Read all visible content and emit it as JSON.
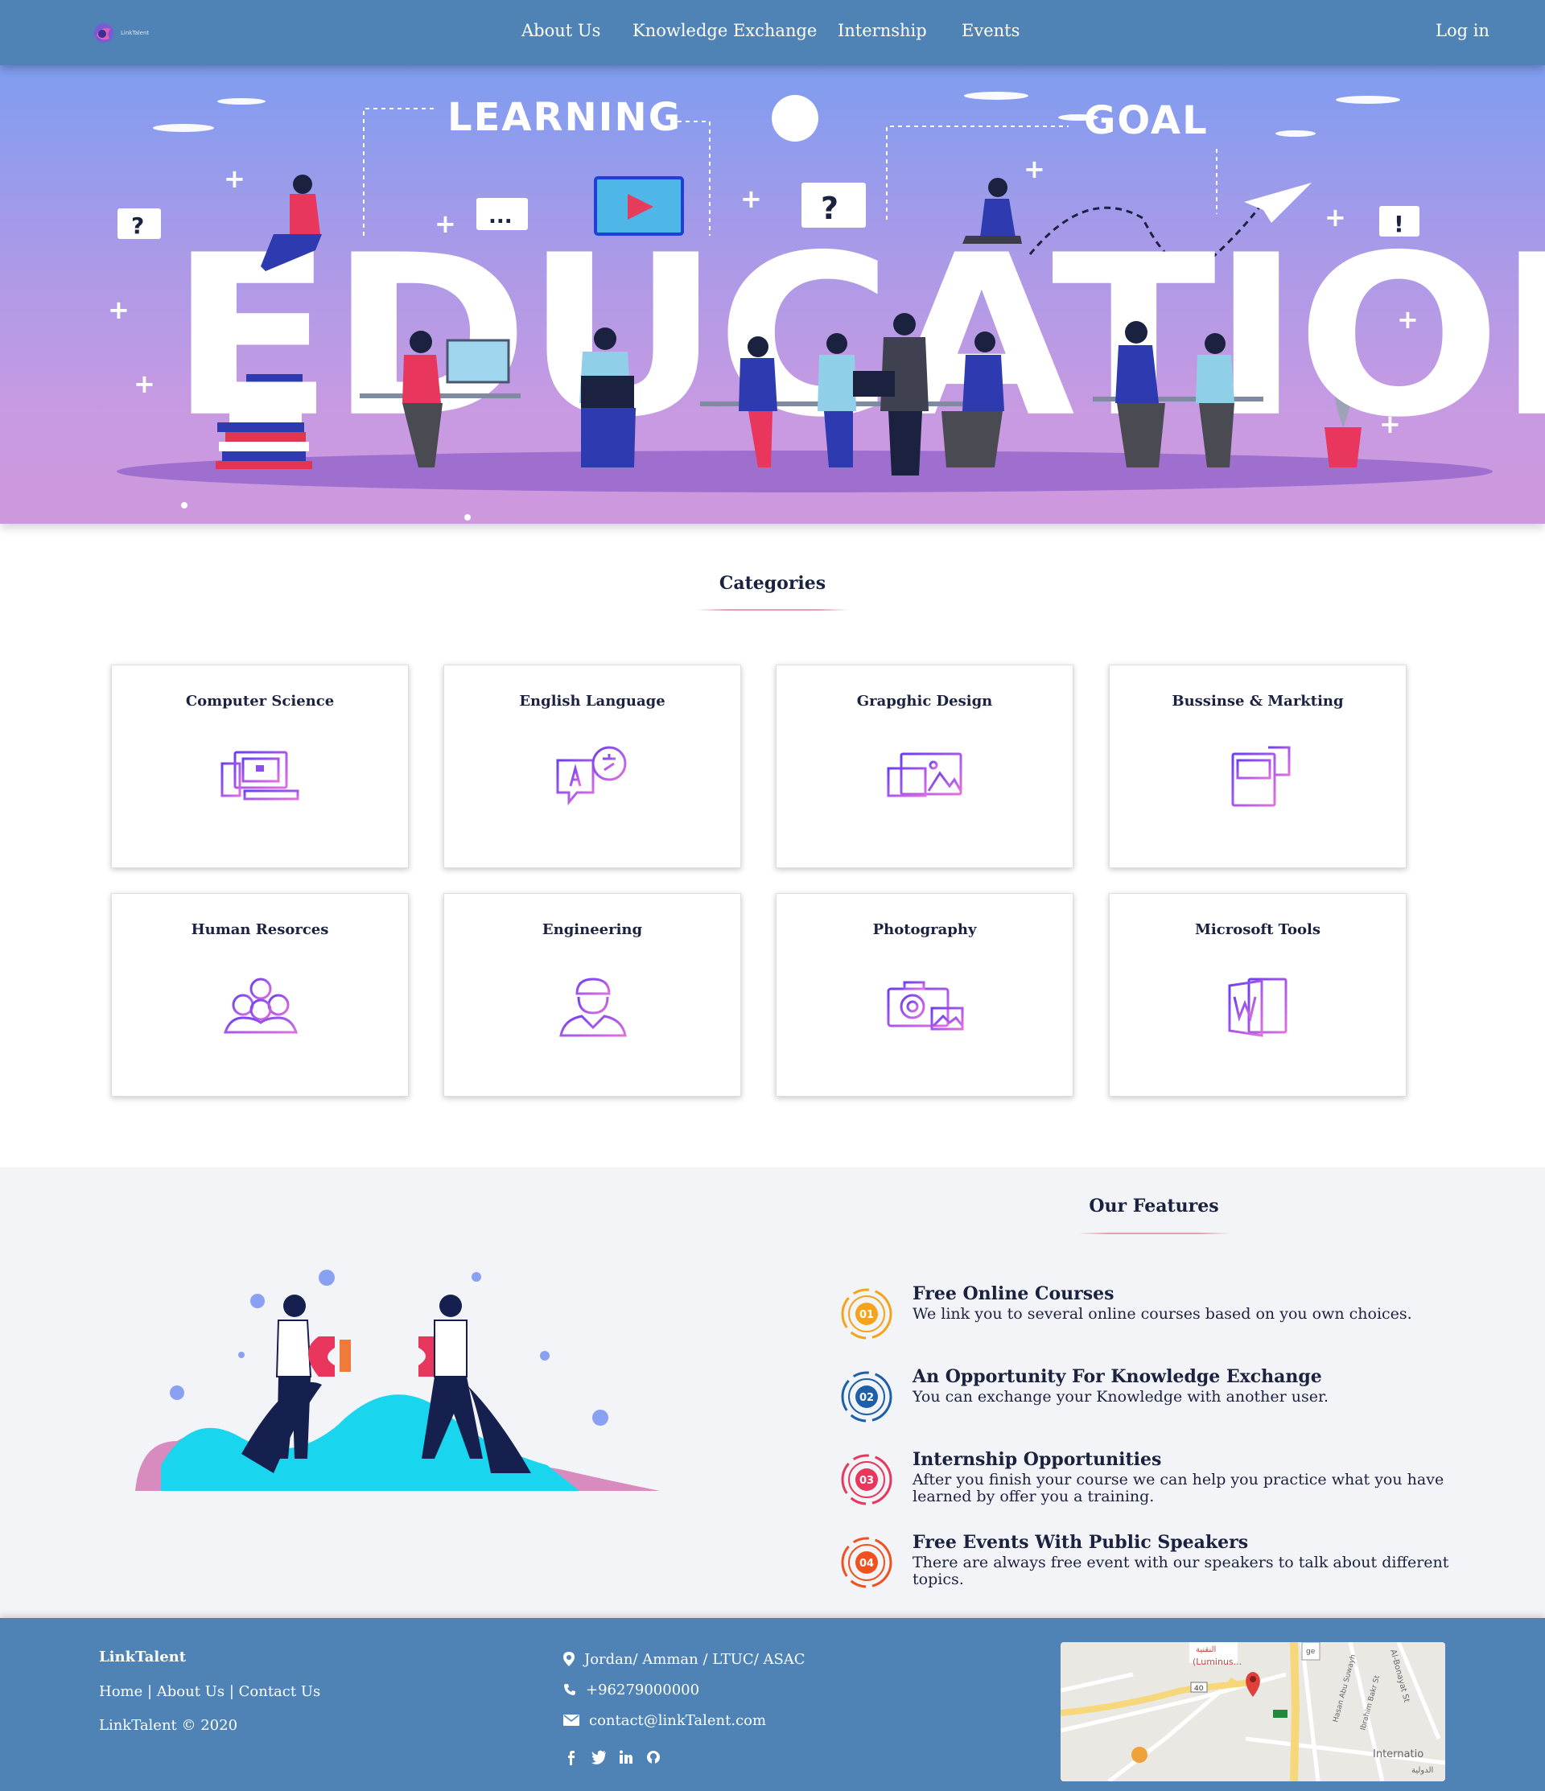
{
  "navbar": {
    "logo_text": "LinkTalent",
    "links": [
      "About Us",
      "Knowledge Exchange",
      "Internship",
      "Events"
    ],
    "login": "Log in"
  },
  "hero": {
    "word_learning": "LEARNING",
    "word_goal": "GOAL",
    "word_education": "EDUCATION",
    "bubble_question": "?",
    "bubble_dots": "...",
    "bubble_exclaim": "!"
  },
  "categories": {
    "title": "Categories",
    "items": [
      {
        "label": "Computer Science",
        "icon": "computer-icon"
      },
      {
        "label": "English Language",
        "icon": "language-icon"
      },
      {
        "label": "Grapghic Design",
        "icon": "graphic-design-icon"
      },
      {
        "label": "Bussinse & Markting",
        "icon": "business-document-icon"
      },
      {
        "label": "Human Resorces",
        "icon": "people-group-icon"
      },
      {
        "label": "Engineering",
        "icon": "engineer-icon"
      },
      {
        "label": "Photography",
        "icon": "camera-icon"
      },
      {
        "label": "Microsoft Tools",
        "icon": "word-document-icon"
      }
    ]
  },
  "features": {
    "title": "Our Features",
    "items": [
      {
        "num": "01",
        "title": "Free Online Courses",
        "text": "We link you to several online courses based on you own choices.",
        "color": "#f5a31a"
      },
      {
        "num": "02",
        "title": "An Opportunity For Knowledge Exchange",
        "text": "You can exchange your Knowledge with another user.",
        "color": "#1d5fa8"
      },
      {
        "num": "03",
        "title": "Internship Opportunities",
        "text": "After you finish your course we can help you practice what you have learned by offer you a training.",
        "color": "#e8365c"
      },
      {
        "num": "04",
        "title": "Free Events With Public Speakers",
        "text": "There are always free event with our speakers to talk about different topics.",
        "color": "#f0521f"
      }
    ]
  },
  "footer": {
    "brand": "LinkTalent",
    "links": [
      "Home",
      "About Us",
      "Contact Us"
    ],
    "separator": " | ",
    "copyright": "LinkTalent © 2020",
    "address": "Jordan/ Amman / LTUC/ ASAC",
    "phone": "+96279000000",
    "email": "contact@linkTalent.com",
    "social": [
      "facebook-icon",
      "twitter-icon",
      "linkedin-icon",
      "github-icon"
    ],
    "map_labels": {
      "place": "(Luminus...",
      "arabic": "النقنية",
      "road": "40",
      "street1": "Al-Bonayat St",
      "street2": "Hasan Abu Suwayh",
      "street3": "Ibrahim Bakr St",
      "corner": "ge",
      "internation": "Internatio",
      "arabic2": "الدولية"
    }
  },
  "colors": {
    "nav": "#4f82b5",
    "hero_top": "#7f9df0",
    "hero_bottom": "#cf98dd",
    "accent_purple": "#8b4cf0",
    "accent_pink": "#d56fe0"
  }
}
